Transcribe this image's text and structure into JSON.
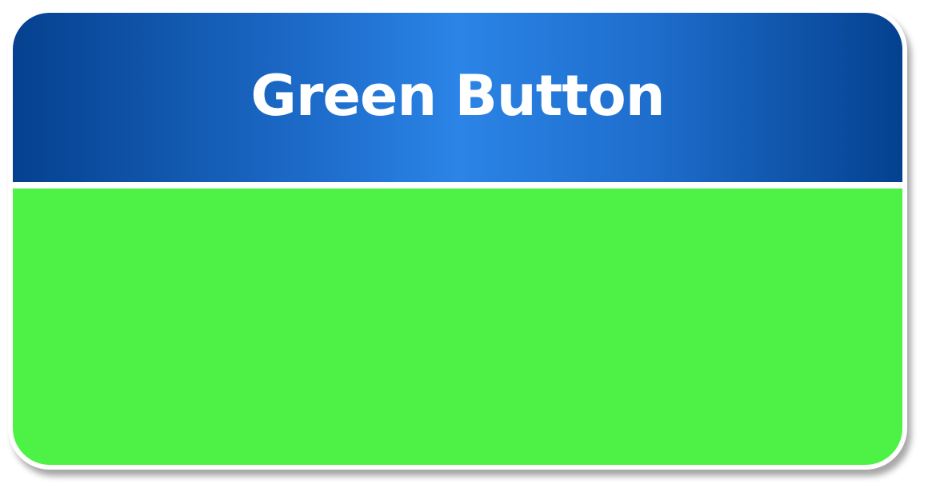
{
  "button": {
    "title": "Green Button"
  },
  "colors": {
    "header_gradient_dark": "#05418f",
    "header_gradient_light": "#2b84e6",
    "button_fill": "#4ef247",
    "title_text": "#ffffff",
    "background": "#ffffff"
  }
}
